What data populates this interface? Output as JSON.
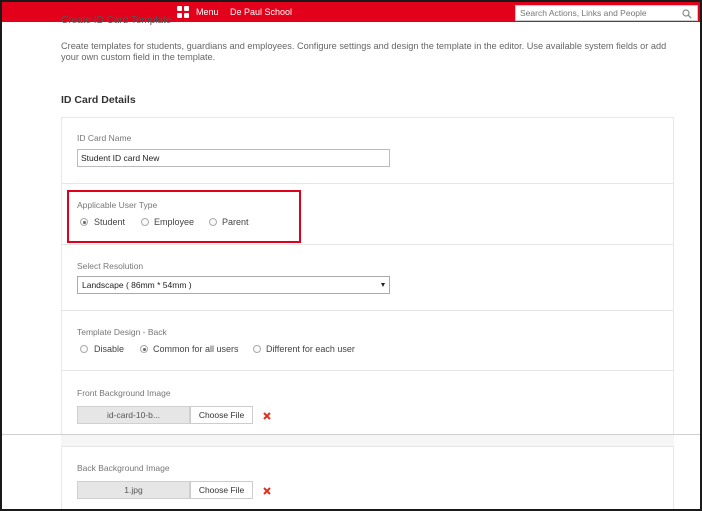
{
  "topbar": {
    "menu_label": "Menu",
    "school_name": "De Paul School",
    "search_placeholder": "Search Actions, Links and People",
    "icons": {
      "menu": "grid-icon",
      "search": "search-icon"
    },
    "brand_color": "#e2001a"
  },
  "page": {
    "cut_title": "Create ID Card Template",
    "description": "Create templates for students, guardians and employees. Configure settings and design the template in the editor. Use available system fields or add your own custom field in the template.",
    "section_title": "ID Card Details"
  },
  "fields": {
    "card_name": {
      "label": "ID Card Name",
      "value": "Student ID card New"
    },
    "user_type": {
      "label": "Applicable User Type",
      "options": [
        "Student",
        "Employee",
        "Parent"
      ],
      "selected": "Student",
      "highlight_color": "#e0001b"
    },
    "resolution": {
      "label": "Select Resolution",
      "value": "Landscape ( 86mm * 54mm )"
    },
    "back_design": {
      "label": "Template Design - Back",
      "options": [
        "Disable",
        "Common for all users",
        "Different for each user"
      ],
      "selected": "Common for all users"
    },
    "front_bg": {
      "label": "Front Background Image",
      "file": "id-card-10-b...",
      "button": "Choose File",
      "remove_icon": "remove-x-icon"
    },
    "back_bg": {
      "label": "Back Background Image",
      "file": "1.jpg",
      "button": "Choose File",
      "remove_icon": "remove-x-icon"
    }
  }
}
